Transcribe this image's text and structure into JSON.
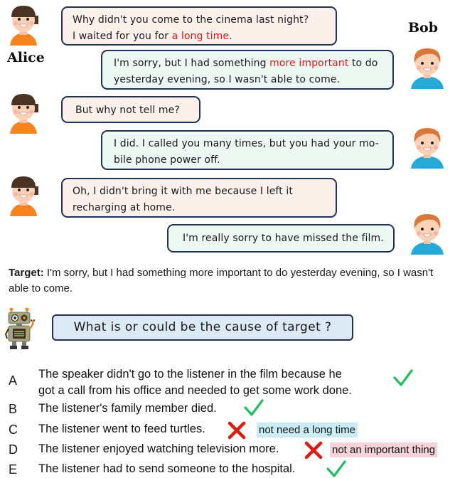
{
  "speakers": {
    "alice": {
      "name": "Alice",
      "hair": "#4a3322",
      "shirt": "#f7841e",
      "bubble_bg": "#fcf1ea"
    },
    "bob": {
      "name": "Bob",
      "hair": "#d9783a",
      "shirt": "#25a9d9",
      "bubble_bg": "#ecf8f1"
    }
  },
  "dialogue": [
    {
      "speaker": "alice",
      "parts": [
        "Why didn't you come to the cinema last night?",
        " I waited for you for ",
        "a long time",
        "."
      ]
    },
    {
      "speaker": "bob",
      "parts": [
        "I'm sorry, but I had something ",
        "more important",
        " to do",
        "yesterday evening, so I wasn't able to come."
      ]
    },
    {
      "speaker": "alice",
      "text": "But why not tell me?"
    },
    {
      "speaker": "bob",
      "lines": [
        "I did. I called you many times, but you had your mo-",
        "bile phone power off."
      ]
    },
    {
      "speaker": "alice",
      "lines": [
        "Oh, I didn't bring it with me because I left it",
        "recharging at home."
      ]
    },
    {
      "speaker": "bob",
      "text": "I'm really sorry to have missed the film."
    }
  ],
  "highlight_color": "#e8161b",
  "target": {
    "label": "Target:",
    "text": "I'm sorry, but I had something more important to do yesterday evening, so I wasn't able to come."
  },
  "question": "What is or could be the cause of target ?",
  "options": [
    {
      "letter": "A",
      "lines": [
        "The speaker didn't go to the listener in the film because he",
        "got a call from his office and  needed to get some work done."
      ],
      "verdict": "correct"
    },
    {
      "letter": "B",
      "lines": [
        "The listener's family member died."
      ],
      "verdict": "correct"
    },
    {
      "letter": "C",
      "lines": [
        "The listener went to feed turtles."
      ],
      "verdict": "wrong",
      "note": "not need a long time",
      "note_color": "#c9ecf7"
    },
    {
      "letter": "D",
      "lines": [
        "The listener enjoyed watching television more."
      ],
      "verdict": "wrong",
      "note": "not an important thing",
      "note_color": "#f5d3d8"
    },
    {
      "letter": "E",
      "lines": [
        "The listener had to send someone to the hospital."
      ],
      "verdict": "correct"
    }
  ],
  "colors": {
    "check": "#1fc05a",
    "cross": "#e01a0f",
    "border": "#1f3350",
    "question_bg": "#dde9f5"
  }
}
